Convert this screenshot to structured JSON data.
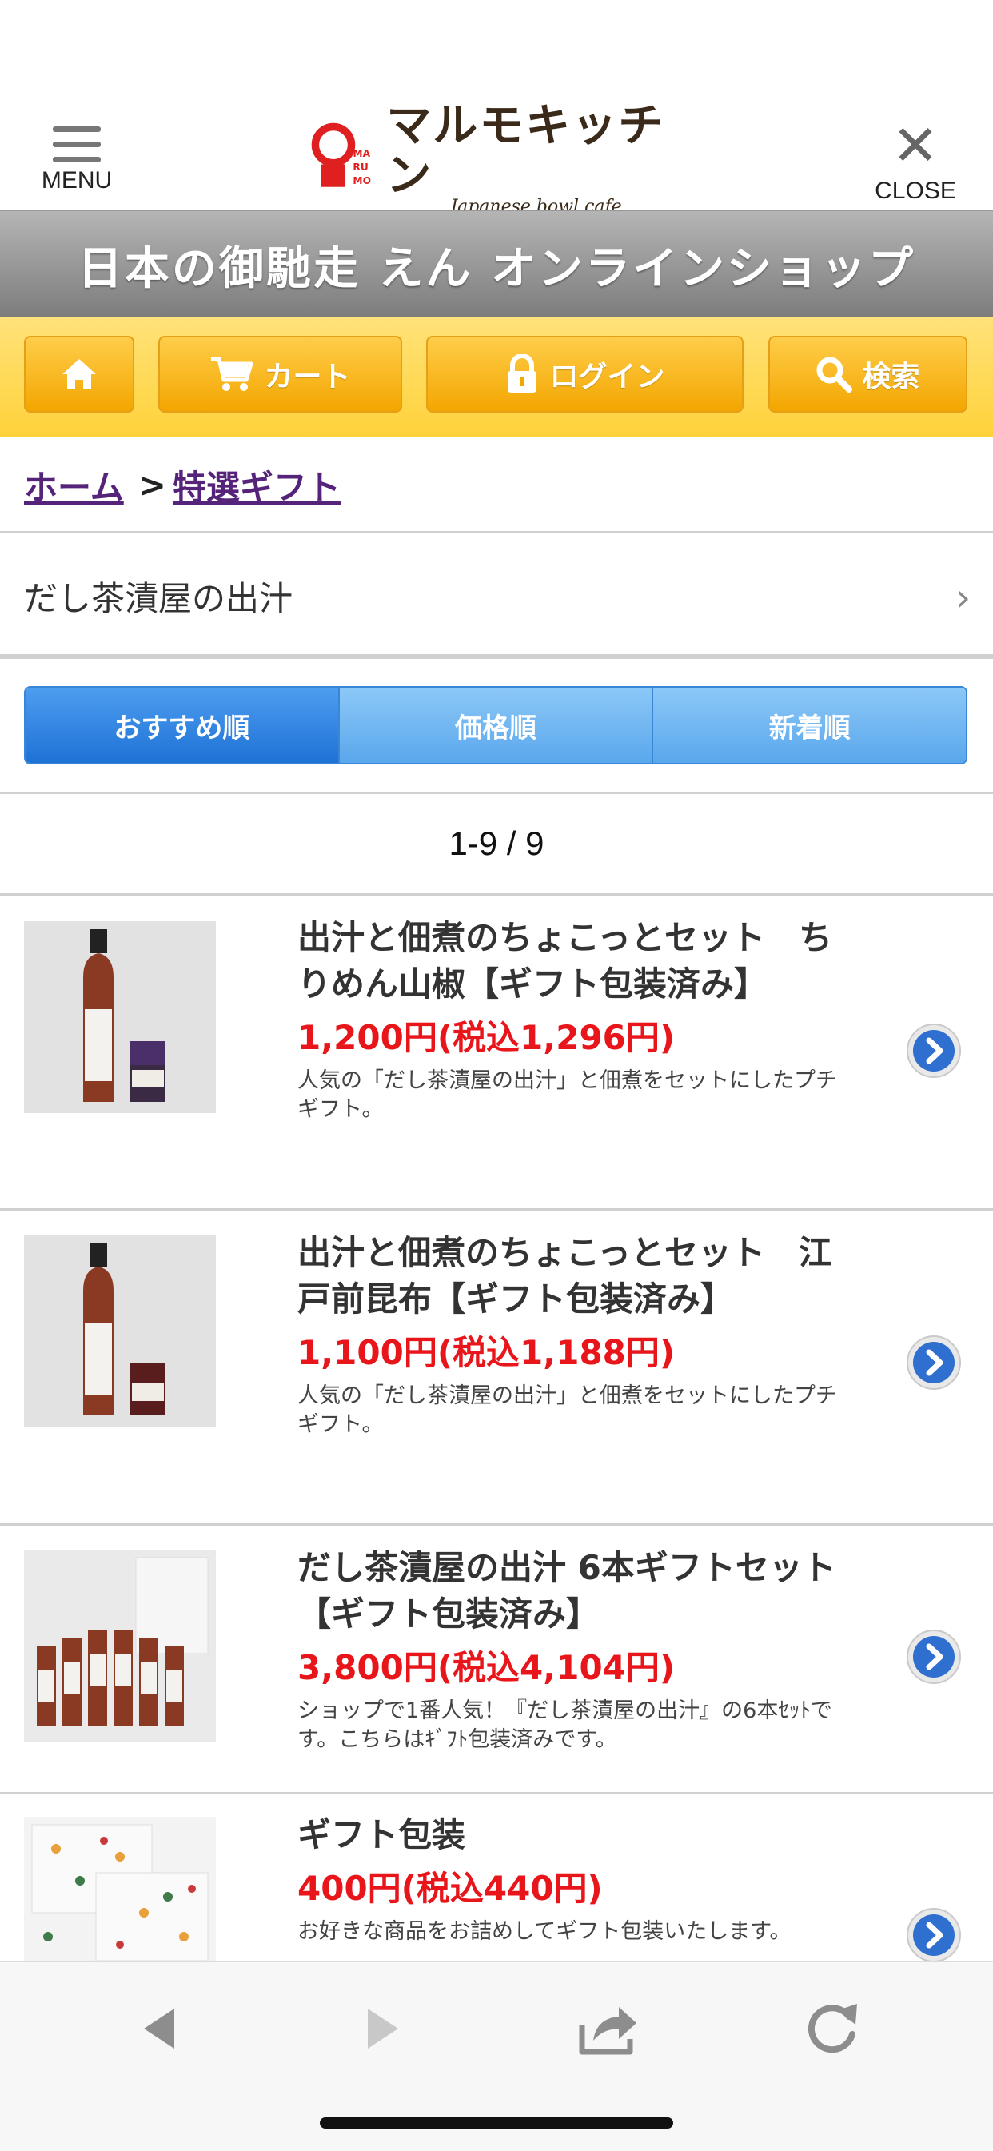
{
  "header": {
    "menu_label": "MENU",
    "close_label": "CLOSE",
    "logo_brand": "マルモキッチン",
    "logo_mark": "MARUMO",
    "logo_sub": "Japanese bowl cafe"
  },
  "banner": {
    "title": "日本の御馳走 えん オンラインショップ"
  },
  "nav": {
    "cart": "カート",
    "login": "ログイン",
    "search": "検索"
  },
  "breadcrumb": {
    "home": "ホーム",
    "separator": ">",
    "current": "特選ギフト"
  },
  "category": {
    "label": "だし茶漬屋の出汁"
  },
  "sort": {
    "tabs": [
      "おすすめ順",
      "価格順",
      "新着順"
    ],
    "active_index": 0
  },
  "results": {
    "count": "1-9 / 9"
  },
  "products": [
    {
      "name": "出汁と佃煮のちょこっとセット　ちりめん山椒【ギフト包装済み】",
      "price": "1,200円(税込1,296円)",
      "desc": "人気の「だし茶漬屋の出汁」と佃煮をセットにしたプチギフト。"
    },
    {
      "name": "出汁と佃煮のちょこっとセット　江戸前昆布【ギフト包装済み】",
      "price": "1,100円(税込1,188円)",
      "desc": "人気の「だし茶漬屋の出汁」と佃煮をセットにしたプチギフト。"
    },
    {
      "name": "だし茶漬屋の出汁 6本ギフトセット【ギフト包装済み】",
      "price": "3,800円(税込4,104円)",
      "desc": "ショップで1番人気！『だし茶漬屋の出汁』の6本ｾｯﾄです。こちらはｷﾞﾌﾄ包装済みです。"
    },
    {
      "name": "ギフト包装",
      "price": "400円(税込440円)",
      "desc": "お好きな商品をお詰めしてギフト包装いたします。"
    }
  ],
  "colors": {
    "accent_yellow": "#ffd23a",
    "price_red": "#e8151b",
    "link_purple": "#55237a",
    "tab_blue": "#1f72d6"
  },
  "icons": {
    "nav": [
      "home-icon",
      "cart-icon",
      "lock-icon",
      "search-icon"
    ],
    "browser": [
      "back-icon",
      "forward-icon",
      "share-icon",
      "reload-icon"
    ]
  }
}
